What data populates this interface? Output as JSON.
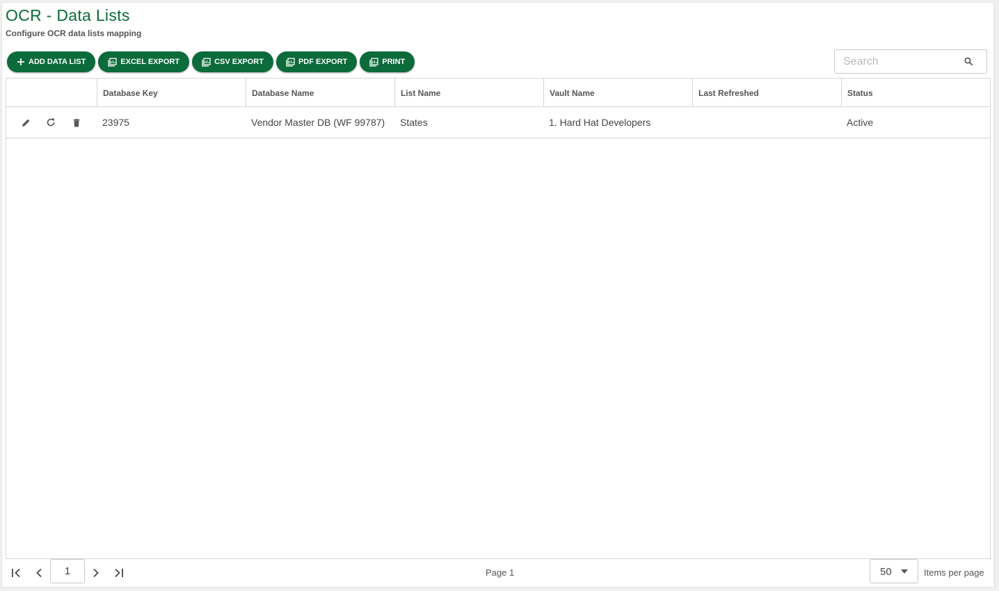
{
  "page": {
    "title": "OCR - Data Lists",
    "subtitle": "Configure OCR data lists mapping"
  },
  "toolbar": {
    "add_label": "ADD DATA LIST",
    "excel_label": "EXCEL EXPORT",
    "csv_label": "CSV EXPORT",
    "pdf_label": "PDF EXPORT",
    "print_label": "PRINT"
  },
  "search": {
    "placeholder": "Search",
    "value": ""
  },
  "table": {
    "columns": [
      "Database Key",
      "Database Name",
      "List Name",
      "Vault Name",
      "Last Refreshed",
      "Status"
    ],
    "rows": [
      {
        "database_key": "23975",
        "database_name": "Vendor Master DB (WF 99787)",
        "list_name": "States",
        "vault_name": "1. Hard Hat Developers",
        "last_refreshed": "",
        "status": "Active"
      }
    ]
  },
  "pager": {
    "current_page": "1",
    "page_label": "Page 1",
    "items_per_page": "50",
    "items_per_page_label": "Items per page"
  },
  "colors": {
    "brand": "#0b6b3a",
    "border": "#d6d6d6",
    "icon": "#555555"
  },
  "icons": {
    "add": "plus-icon",
    "export": "export-icon",
    "search": "search-icon",
    "edit": "pencil-icon",
    "refresh": "refresh-icon",
    "delete": "trash-icon",
    "first": "first-page-icon",
    "prev": "chevron-left-icon",
    "next": "chevron-right-icon",
    "last": "last-page-icon",
    "dropdown": "caret-down-icon"
  }
}
